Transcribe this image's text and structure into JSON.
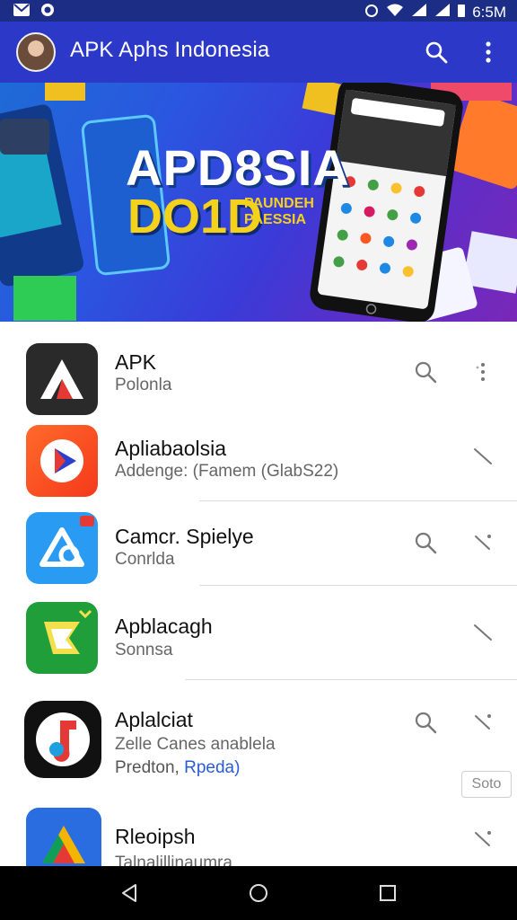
{
  "status_bar": {
    "time": "6:5M"
  },
  "app_bar": {
    "title": "APK Aphs Indonesia"
  },
  "banner": {
    "headline": "APD8SIA",
    "subheadline": "DO1D",
    "tagline": "PAUNDEH PAESSIA"
  },
  "apps": [
    {
      "title": "APK",
      "subtitle": "Polonla"
    },
    {
      "title": "Apliabaolsia",
      "subtitle": "Addenge: (Famem (GlabS22)"
    },
    {
      "title": "Camcr. Spielye",
      "subtitle": "Conrlda"
    },
    {
      "title": "Apblacagh",
      "subtitle": "Sonnsa"
    },
    {
      "title": "Aplalciat",
      "subtitle": "Zelle Canes anablela",
      "subtitle2": "Predton,",
      "link": "Rpeda)"
    },
    {
      "title": "Rleoipsh",
      "subtitle": "Talnalillinaumra"
    }
  ],
  "chip_label": "Soto"
}
